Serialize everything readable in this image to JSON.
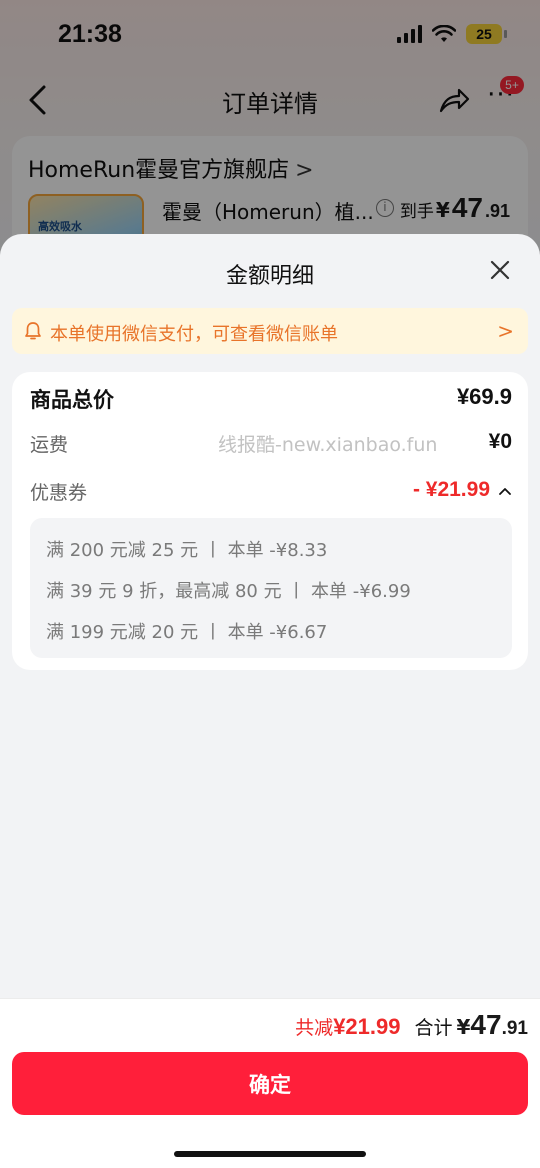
{
  "status_bar": {
    "time": "21:38",
    "battery": "25"
  },
  "nav": {
    "title": "订单详情",
    "badge": "5+"
  },
  "store": {
    "name": "HomeRun霍曼官方旗舰店",
    "chevron": ">",
    "product_title": "霍曼（Homerun）植...",
    "thumb_text": "高效吸水",
    "price_label": "到手",
    "price_yen": "¥",
    "price_int": "47",
    "price_dec": ".91"
  },
  "sheet": {
    "title": "金额明细",
    "notice": "本单使用微信支付，可查看微信账单",
    "notice_chevron": ">",
    "rows": {
      "goods_total_label": "商品总价",
      "goods_total_value": "¥69.9",
      "shipping_label": "运费",
      "shipping_value": "¥0",
      "watermark": "线报酷-new.xianbao.fun",
      "coupon_label": "优惠券",
      "coupon_value": "- ¥21.99"
    },
    "coupon_details": [
      "满 200 元减 25 元  丨 本单 -¥8.33",
      "满 39 元 9 折，最高减 80 元  丨 本单 -¥6.99",
      "满 199 元减 20 元  丨 本单 -¥6.67"
    ]
  },
  "footer": {
    "saved_label": "共减",
    "saved_amount": "¥21.99",
    "sum_label": "合计",
    "sum_yen": "¥",
    "sum_int": "47",
    "sum_dec": ".91",
    "confirm_label": "确定"
  },
  "colors": {
    "accent_red": "#ff1f3a",
    "price_red": "#ee2a2a",
    "notice_orange": "#e8742a",
    "notice_bg": "#fff6dd"
  },
  "icons": [
    "back-icon",
    "share-icon",
    "more-icon",
    "info-icon",
    "bell-icon",
    "close-icon",
    "caret-up-icon"
  ]
}
